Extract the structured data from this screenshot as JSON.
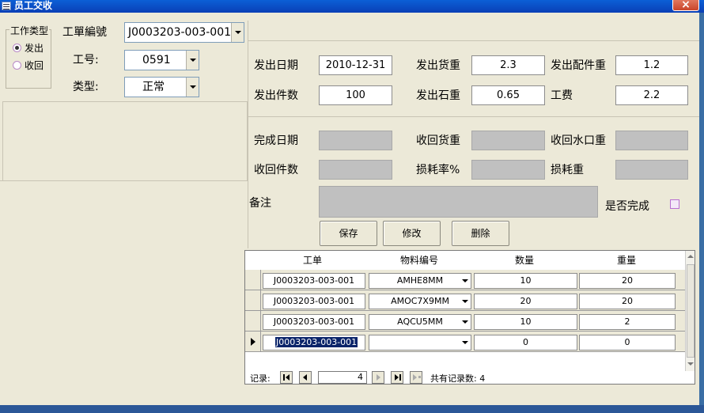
{
  "window": {
    "title": "员工交收",
    "close": "×"
  },
  "work_type": {
    "legend": "工作类型",
    "options": [
      {
        "label": "发出",
        "selected": true
      },
      {
        "label": "收回",
        "selected": false
      }
    ]
  },
  "header": {
    "order_label": "工單編號",
    "order_value": "J0003203-003-001",
    "worker_label": "工号:",
    "worker_value": "0591",
    "type_label": "类型:",
    "type_value": "正常"
  },
  "issue": {
    "date_label": "发出日期",
    "date_value": "2010-12-31",
    "goods_weight_label": "发出货重",
    "goods_weight_value": "2.3",
    "parts_weight_label": "发出配件重",
    "parts_weight_value": "1.2",
    "pieces_label": "发出件数",
    "pieces_value": "100",
    "stone_weight_label": "发出石重",
    "stone_weight_value": "0.65",
    "fee_label": "工费",
    "fee_value": "2.2"
  },
  "receive": {
    "date_label": "完成日期",
    "date_value": "",
    "goods_weight_label": "收回货重",
    "goods_weight_value": "",
    "sprue_weight_label": "收回水口重",
    "sprue_weight_value": "",
    "pieces_label": "收回件数",
    "pieces_value": "",
    "loss_rate_label": "损耗率%",
    "loss_rate_value": "",
    "loss_weight_label": "损耗重",
    "loss_weight_value": ""
  },
  "remarks": {
    "label": "备注",
    "value": "",
    "completed_label": "是否完成"
  },
  "buttons": {
    "save": "保存",
    "edit": "修改",
    "delete": "删除"
  },
  "grid": {
    "columns": [
      "工单",
      "物料编号",
      "数量",
      "重量"
    ],
    "rows": [
      {
        "order": "J0003203-003-001",
        "material": "AMHE8MM",
        "qty": "10",
        "weight": "20"
      },
      {
        "order": "J0003203-003-001",
        "material": "AMOC7X9MM",
        "qty": "20",
        "weight": "20"
      },
      {
        "order": "J0003203-003-001",
        "material": "AQCU5MM",
        "qty": "10",
        "weight": "2"
      },
      {
        "order": "J0003203-003-001",
        "material": "",
        "qty": "0",
        "weight": "0"
      }
    ]
  },
  "navigator": {
    "record_label": "记录:",
    "current": "4",
    "total_label": "共有记录数: 4"
  }
}
